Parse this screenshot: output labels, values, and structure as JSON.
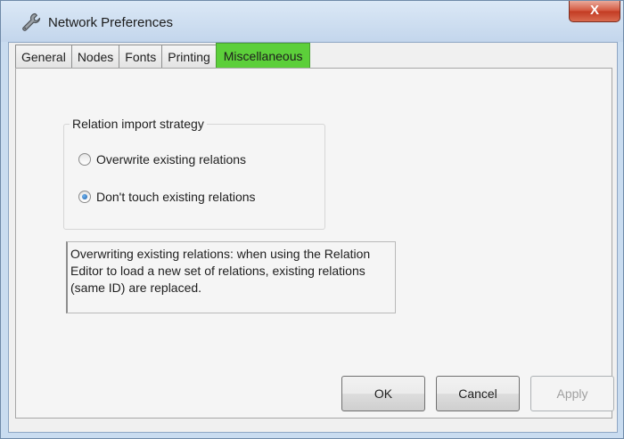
{
  "window": {
    "title": "Network Preferences",
    "title_icon": "wrench-icon",
    "close_label": "X"
  },
  "tabs": [
    {
      "label": "General",
      "active": false
    },
    {
      "label": "Nodes",
      "active": false
    },
    {
      "label": "Fonts",
      "active": false
    },
    {
      "label": "Printing",
      "active": false
    },
    {
      "label": "Miscellaneous",
      "active": true
    }
  ],
  "relation_import": {
    "group_label": "Relation import strategy",
    "options": [
      {
        "label": "Overwrite existing relations",
        "checked": false
      },
      {
        "label": "Don't touch existing relations",
        "checked": true
      }
    ]
  },
  "description": "Overwriting existing relations: when using the Relation\nEditor to load a new set of relations, existing relations\n(same ID) are replaced.",
  "buttons": {
    "ok": "OK",
    "cancel": "Cancel",
    "apply": "Apply",
    "apply_enabled": false
  },
  "colors": {
    "active_tab": "#5ccf3a",
    "close_button": "#c33a22",
    "title_bar": "#c9dcf0"
  }
}
